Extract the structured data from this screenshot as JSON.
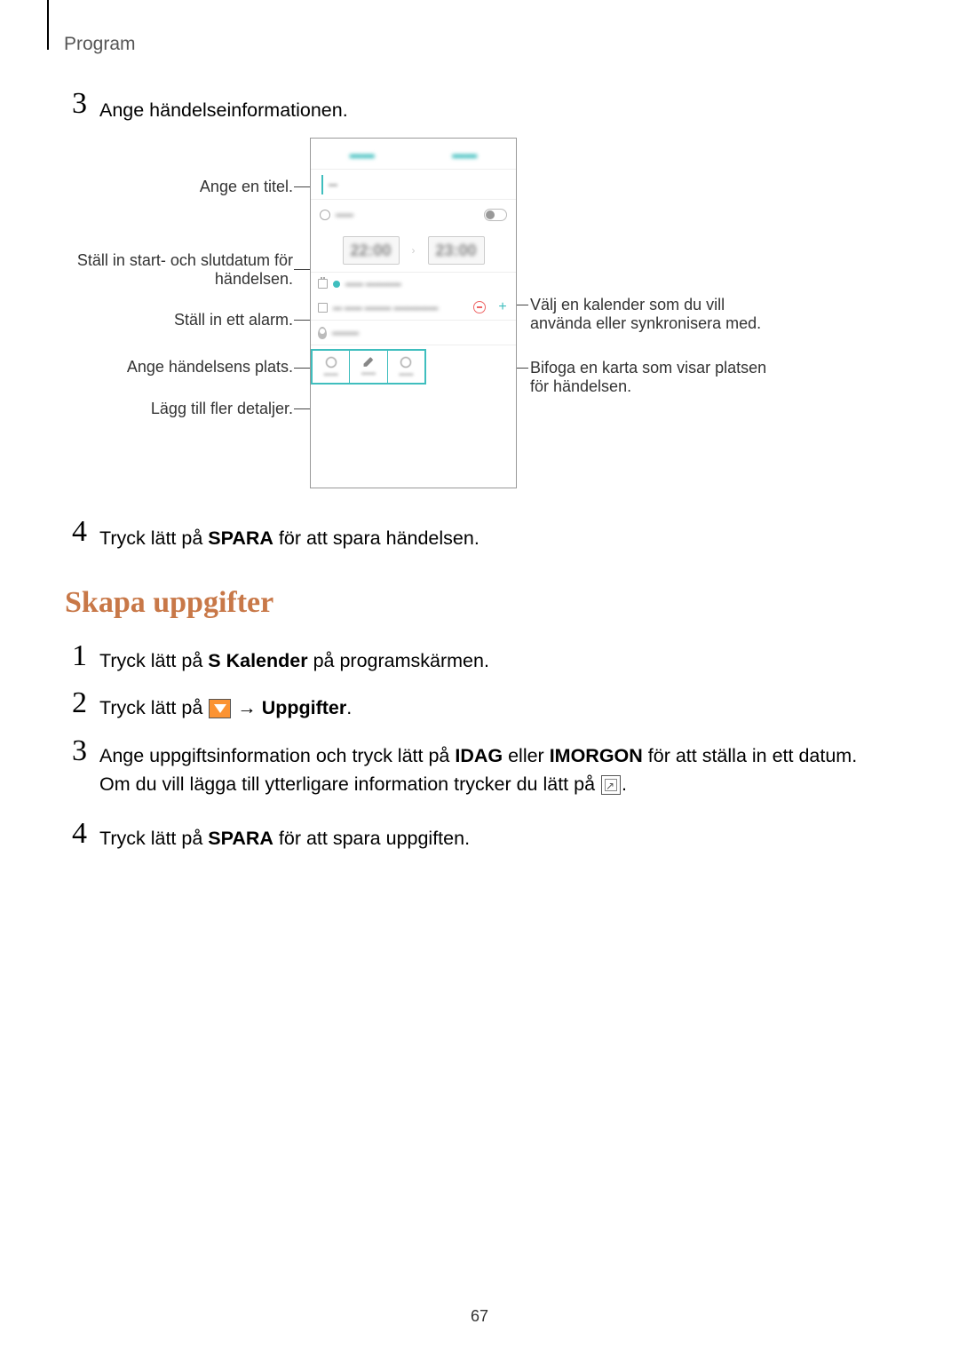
{
  "header": {
    "label": "Program"
  },
  "step3a": {
    "num": "3",
    "text": "Ange händelseinformationen."
  },
  "callouts": {
    "left1": "Ange en titel.",
    "left2a": "Ställ in start- och slutdatum för",
    "left2b": "händelsen.",
    "left3": "Ställ in ett alarm.",
    "left4": "Ange händelsens plats.",
    "left5": "Lägg till fler detaljer.",
    "right1a": "Välj en kalender som du vill",
    "right1b": "använda eller synkronisera med.",
    "right2a": "Bifoga en karta som visar platsen",
    "right2b": "för händelsen."
  },
  "phone": {
    "time1": "22:00",
    "time2": "23:00"
  },
  "step4a": {
    "num": "4",
    "text_a": "Tryck lätt på ",
    "bold": "SPARA",
    "text_b": " för att spara händelsen."
  },
  "heading2": "Skapa uppgifter",
  "task1": {
    "num": "1",
    "text_a": "Tryck lätt på ",
    "bold": "S Kalender",
    "text_b": " på programskärmen."
  },
  "task2": {
    "num": "2",
    "text_a": "Tryck lätt på ",
    "arrow": " → ",
    "bold": "Uppgifter",
    "text_b": "."
  },
  "task3": {
    "num": "3",
    "text_a": "Ange uppgiftsinformation och tryck lätt på ",
    "bold1": "IDAG",
    "text_b": " eller ",
    "bold2": "IMORGON",
    "text_c": " för att ställa in ett datum.",
    "line2_a": "Om du vill lägga till ytterligare information trycker du lätt på ",
    "line2_b": "."
  },
  "task4": {
    "num": "4",
    "text_a": "Tryck lätt på ",
    "bold": "SPARA",
    "text_b": " för att spara uppgiften."
  },
  "page_number": "67"
}
